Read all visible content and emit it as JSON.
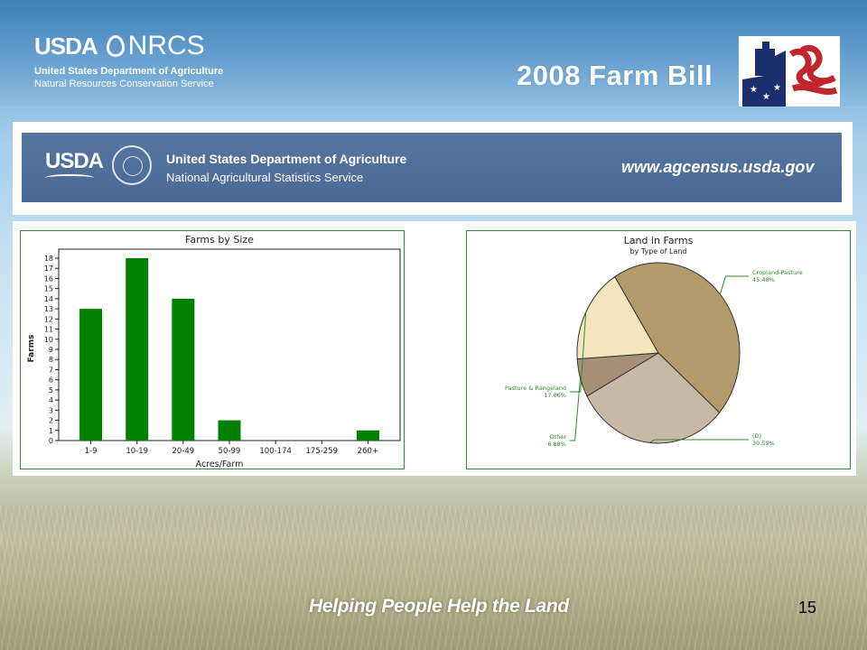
{
  "header": {
    "usda_label": "USDA",
    "nrcs_label": "NRCS",
    "dept_line": "United States Department of Agriculture",
    "service_line": "Natural Resources Conservation Service",
    "title": "2008 Farm Bill"
  },
  "census_banner": {
    "usda_label": "USDA",
    "dept": "United States Department of Agriculture",
    "agency": "National Agricultural Statistics Service",
    "url": "www.agcensus.usda.gov"
  },
  "chart_data": [
    {
      "type": "bar",
      "title": "Farms by Size",
      "xlabel": "Acres/Farm",
      "ylabel": "Farms",
      "categories": [
        "1-9",
        "10-19",
        "20-49",
        "50-99",
        "100-174",
        "175-259",
        "260+"
      ],
      "values": [
        13,
        18,
        14,
        2,
        0,
        0,
        1
      ],
      "ylim": [
        0,
        18
      ],
      "yticks": [
        "0",
        "1",
        "2",
        "3",
        "4",
        "5",
        "6",
        "7",
        "8",
        "9",
        "10",
        "11",
        "12",
        "13",
        "14",
        "15",
        "16",
        "17",
        "18"
      ],
      "grid": false,
      "colors": {
        "bar": "#008000",
        "frame": "#2e8b2e"
      }
    },
    {
      "type": "pie",
      "title": "Land in Farms",
      "subtitle": "by Type of Land",
      "slices": [
        {
          "label": "Cropland-Pasture",
          "percent_label": "45.48%",
          "value": 45.48,
          "color": "#b39a6a"
        },
        {
          "label": "(D)",
          "percent_label": "30.59%",
          "value": 30.59,
          "color": "#c8b8a6"
        },
        {
          "label": "Other",
          "percent_label": "6.88%",
          "value": 6.88,
          "color": "#a89078"
        },
        {
          "label": "Pasture & Rangeland",
          "percent_label": "17.06%",
          "value": 17.06,
          "color": "#f3e6bd"
        }
      ],
      "label_color": "#2e8b2e"
    }
  ],
  "footer": {
    "tagline": "Helping People Help the Land",
    "slide_number": "15"
  }
}
